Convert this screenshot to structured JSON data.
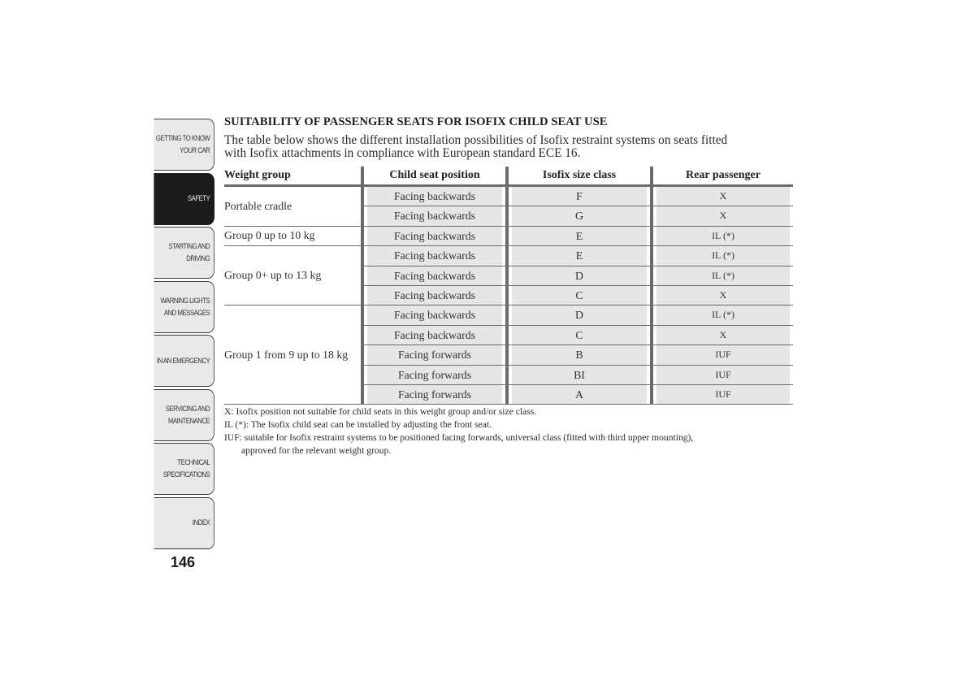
{
  "sidebar": {
    "tabs": [
      {
        "label_lines": [
          "GETTING TO KNOW",
          "YOUR CAR"
        ],
        "active": false
      },
      {
        "label_lines": [
          "SAFETY"
        ],
        "active": true
      },
      {
        "label_lines": [
          "STARTING AND",
          "DRIVING"
        ],
        "active": false
      },
      {
        "label_lines": [
          "WARNING LIGHTS",
          "AND MESSAGES"
        ],
        "active": false
      },
      {
        "label_lines": [
          "IN AN EMERGENCY"
        ],
        "active": false
      },
      {
        "label_lines": [
          "SERVICING AND",
          "MAINTENANCE"
        ],
        "active": false
      },
      {
        "label_lines": [
          "TECHNICAL",
          "SPECIFICATIONS"
        ],
        "active": false
      },
      {
        "label_lines": [
          "INDEX"
        ],
        "active": false
      }
    ]
  },
  "page_number": "146",
  "section": {
    "title": "SUITABILITY OF PASSENGER SEATS FOR ISOFIX CHILD SEAT USE",
    "intro_line1": "The table below shows the different installation possibilities of Isofix restraint systems on seats fitted",
    "intro_line2": "with Isofix attachments in compliance with European standard ECE 16."
  },
  "table": {
    "headers": [
      "Weight group",
      "Child seat position",
      "Isofix size class",
      "Rear passenger"
    ],
    "groups": [
      {
        "label": "Portable cradle",
        "rows": [
          {
            "position": "Facing backwards",
            "size_class": "F",
            "rear": "X"
          },
          {
            "position": "Facing backwards",
            "size_class": "G",
            "rear": "X"
          }
        ]
      },
      {
        "label": "Group 0 up to 10 kg",
        "rows": [
          {
            "position": "Facing backwards",
            "size_class": "E",
            "rear": "IL (*)"
          }
        ]
      },
      {
        "label": "Group 0+ up to 13 kg",
        "rows": [
          {
            "position": "Facing backwards",
            "size_class": "E",
            "rear": "IL (*)"
          },
          {
            "position": "Facing backwards",
            "size_class": "D",
            "rear": "IL (*)"
          },
          {
            "position": "Facing backwards",
            "size_class": "C",
            "rear": "X"
          }
        ]
      },
      {
        "label": "Group 1 from 9 up to 18 kg",
        "rows": [
          {
            "position": "Facing backwards",
            "size_class": "D",
            "rear": "IL (*)"
          },
          {
            "position": "Facing backwards",
            "size_class": "C",
            "rear": "X"
          },
          {
            "position": "Facing forwards",
            "size_class": "B",
            "rear": "IUF"
          },
          {
            "position": "Facing forwards",
            "size_class": "BI",
            "rear": "IUF"
          },
          {
            "position": "Facing forwards",
            "size_class": "A",
            "rear": "IUF"
          }
        ]
      }
    ]
  },
  "notes": {
    "x": "X: Isofix position not suitable for child seats in this weight group and/or size class.",
    "il": "IL (*): The Isofix child seat can be installed by adjusting the front seat.",
    "iuf_line1": "IUF: suitable for Isofix restraint systems to be positioned facing forwards, universal class (fitted with third upper mounting),",
    "iuf_line2": "approved for the relevant weight group."
  },
  "colors": {
    "active_tab": "#1b1b1b",
    "tab_bg": "#e9e9e9",
    "cell_bg": "#e6e6e6",
    "rule": "#6b6b6b"
  }
}
